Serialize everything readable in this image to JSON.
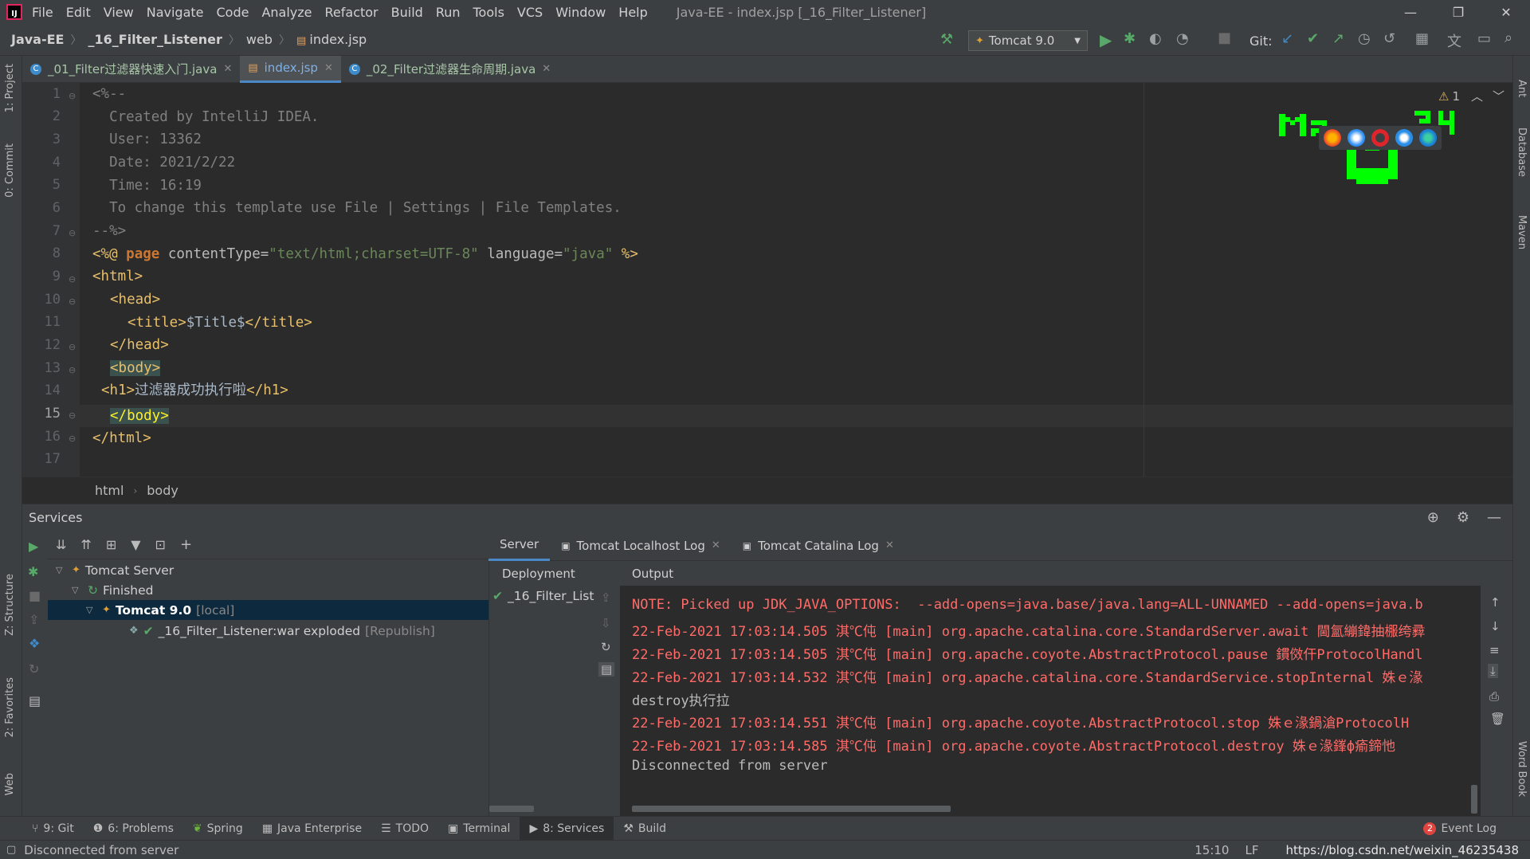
{
  "menubar": {
    "items": [
      "File",
      "Edit",
      "View",
      "Navigate",
      "Code",
      "Analyze",
      "Refactor",
      "Build",
      "Run",
      "Tools",
      "VCS",
      "Window",
      "Help"
    ],
    "window_title": "Java-EE - index.jsp [_16_Filter_Listener]"
  },
  "navbar": {
    "crumbs": [
      "Java-EE",
      "_16_Filter_Listener",
      "web",
      "index.jsp"
    ],
    "run_config": "Tomcat 9.0",
    "git_label": "Git:"
  },
  "tabs": [
    {
      "label": "_01_Filter过滤器快速入门.java",
      "active": false
    },
    {
      "label": "index.jsp",
      "active": true
    },
    {
      "label": "_02_Filter过滤器生命周期.java",
      "active": false
    }
  ],
  "editor": {
    "line_numbers": [
      "1",
      "2",
      "3",
      "4",
      "5",
      "6",
      "7",
      "8",
      "9",
      "10",
      "11",
      "12",
      "13",
      "14",
      "15",
      "16",
      "17"
    ],
    "current_line": "15",
    "lines": {
      "l1": "<%--",
      "l2": "  Created by IntelliJ IDEA.",
      "l3": "  User: 13362",
      "l4": "  Date: 2021/2/22",
      "l5": "  Time: 16:19",
      "l6": "  To change this template use File | Settings | File Templates.",
      "l7": "--%>",
      "l8_a": "<%@ ",
      "l8_b": "page",
      "l8_c": " contentType=",
      "l8_d": "\"text/html;charset=UTF-8\"",
      "l8_e": " language=",
      "l8_f": "\"java\"",
      "l8_g": " %>",
      "l9": "<html>",
      "l10": "<head>",
      "l11_a": "<title>",
      "l11_b": "$Title$",
      "l11_c": "</title>",
      "l12": "</head>",
      "l13": "<body>",
      "l14_a": "<h1>",
      "l14_b": "过滤器成功执行啦",
      "l14_c": "</h1>",
      "l15": "</body>",
      "l16": "</html>"
    },
    "warning_count": "1",
    "breadcrumb": [
      "html",
      "body"
    ]
  },
  "left_stripe": [
    "1: Project",
    "0: Commit",
    "Z: Structure",
    "2: Favorites",
    "Web"
  ],
  "right_stripe": [
    "Ant",
    "Database",
    "Maven",
    "Word Book"
  ],
  "services": {
    "title": "Services",
    "tree": {
      "root": "Tomcat Server",
      "status": "Finished",
      "server": "Tomcat 9.0",
      "server_suffix": "[local]",
      "artifact": "_16_Filter_Listener:war exploded",
      "artifact_suffix": "[Republish]"
    },
    "tabs": [
      {
        "label": "Server",
        "active": true
      },
      {
        "label": "Tomcat Localhost Log",
        "active": false
      },
      {
        "label": "Tomcat Catalina Log",
        "active": false
      }
    ],
    "deployment_header": "Deployment",
    "deployment_item": "_16_Filter_List",
    "output_header": "Output",
    "console": [
      {
        "type": "err",
        "text": "NOTE: Picked up JDK_JAVA_OPTIONS:  --add-opens=java.base/java.lang=ALL-UNNAMED --add-opens=java.b"
      },
      {
        "type": "err",
        "text": "22-Feb-2021 17:03:14.505 淇℃伅 [main] org.apache.catalina.core.StandardServer.await 閫氳繃鍏抽棴绔彛"
      },
      {
        "type": "err",
        "text": "22-Feb-2021 17:03:14.505 淇℃伅 [main] org.apache.coyote.AbstractProtocol.pause 鏆傚仠ProtocolHandl"
      },
      {
        "type": "err",
        "text": "22-Feb-2021 17:03:14.532 淇℃伅 [main] org.apache.catalina.core.StandardService.stopInternal 姝ｅ湪"
      },
      {
        "type": "ok",
        "text": "destroy执行拉"
      },
      {
        "type": "err",
        "text": "22-Feb-2021 17:03:14.551 淇℃伅 [main] org.apache.coyote.AbstractProtocol.stop 姝ｅ湪鍋滄ProtocolH"
      },
      {
        "type": "err",
        "text": "22-Feb-2021 17:03:14.585 淇℃伅 [main] org.apache.coyote.AbstractProtocol.destroy 姝ｅ湪鎽ф瘉鍗忚"
      },
      {
        "type": "ok",
        "text": "Disconnected from server"
      }
    ]
  },
  "bottom_tabs": [
    {
      "label": "9: Git",
      "icon": "git-icon",
      "active": false
    },
    {
      "label": "6: Problems",
      "icon": "problems-icon",
      "active": false
    },
    {
      "label": "Spring",
      "icon": "spring-icon",
      "active": false
    },
    {
      "label": "Java Enterprise",
      "icon": "java-enterprise-icon",
      "active": false
    },
    {
      "label": "TODO",
      "icon": "todo-icon",
      "active": false
    },
    {
      "label": "Terminal",
      "icon": "terminal-icon",
      "active": false
    },
    {
      "label": "8: Services",
      "icon": "services-icon",
      "active": true
    },
    {
      "label": "Build",
      "icon": "build-icon",
      "active": false
    }
  ],
  "event_log": {
    "count": "2",
    "label": "Event Log"
  },
  "statusbar": {
    "message": "Disconnected from server",
    "position": "15:10",
    "line_sep": "LF",
    "watermark": "https://blog.csdn.net/weixin_46235438"
  },
  "colors": {
    "accent": "#4a88c7",
    "error_text": "#ff6b68",
    "run_green": "#59a869",
    "pixel_green": "#00ff00"
  }
}
